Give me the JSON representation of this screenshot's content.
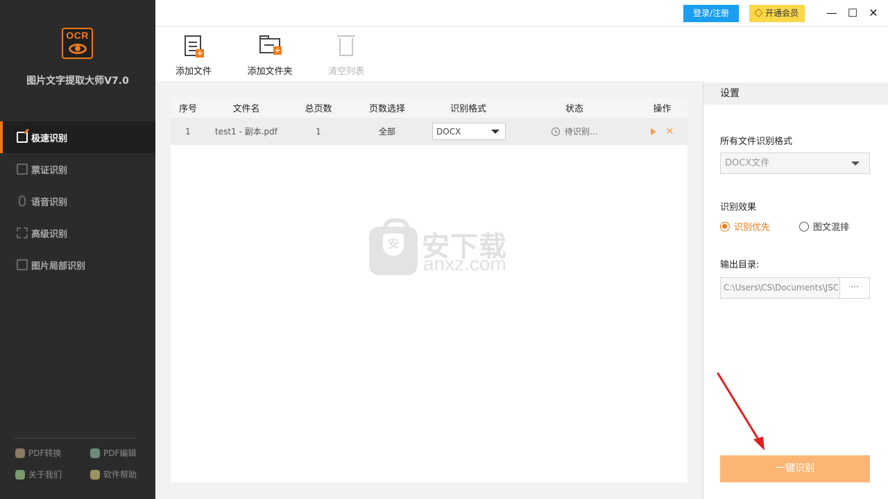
{
  "sidebar": {
    "logo_text": "OCR",
    "app_title": "图片文字提取大师V7.0",
    "items": [
      {
        "label": "极速识别",
        "icon": "fast-ocr-icon",
        "active": true
      },
      {
        "label": "票证识别",
        "icon": "ticket-icon"
      },
      {
        "label": "语音识别",
        "icon": "microphone-icon"
      },
      {
        "label": "高级识别",
        "icon": "scan-icon"
      },
      {
        "label": "图片局部识别",
        "icon": "image-crop-icon"
      }
    ],
    "bottom_links": [
      {
        "label": "PDF转换",
        "icon": "pdf-convert-icon"
      },
      {
        "label": "PDF编辑",
        "icon": "pdf-edit-icon"
      },
      {
        "label": "关于我们",
        "icon": "about-icon"
      },
      {
        "label": "软件帮助",
        "icon": "help-icon"
      }
    ]
  },
  "titlebar": {
    "login_label": "登录/注册",
    "vip_label": "开通会员",
    "minimize": "—",
    "maximize": "☐",
    "close": "✕"
  },
  "toolbar": {
    "add_file": "添加文件",
    "add_folder": "添加文件夹",
    "clear_list": "清空列表"
  },
  "table": {
    "headers": [
      "序号",
      "文件名",
      "总页数",
      "页数选择",
      "识别格式",
      "状态",
      "操作"
    ],
    "rows": [
      {
        "index": "1",
        "filename": "test1 - 副本.pdf",
        "pages": "1",
        "page_select": "全部",
        "format": "DOCX",
        "status": "待识别..."
      }
    ]
  },
  "watermark": {
    "cn": "安下载",
    "en": "anxz.com",
    "shield": "安"
  },
  "settings": {
    "title": "设置",
    "all_format_label": "所有文件识别格式",
    "all_format_value": "DOCX文件",
    "effect_label": "识别效果",
    "effect_options": [
      "识别优先",
      "图文混排"
    ],
    "effect_selected": "识别优先",
    "output_label": "输出目录:",
    "output_path": "C:\\Users\\CS\\Documents\\JSC",
    "browse_label": "···",
    "start_label": "一键识别"
  },
  "colors": {
    "accent": "#ee7a1a",
    "login_blue": "#1b9ef0",
    "vip_yellow": "#fbd84a",
    "start_button": "#fbb676",
    "arrow_red": "#e02020"
  }
}
